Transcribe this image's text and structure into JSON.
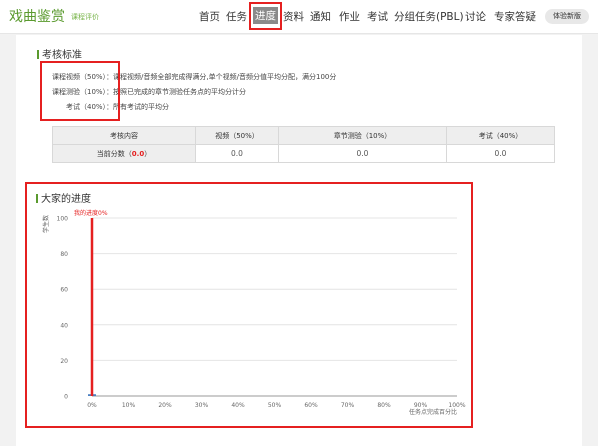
{
  "header": {
    "course_title": "戏曲鉴赏",
    "course_subtitle": "课程评价",
    "nav": [
      "首页",
      "任务",
      "进度",
      "资料",
      "通知",
      "作业",
      "考试",
      "分组任务(PBL)",
      "讨论",
      "专家答疑"
    ],
    "active_nav": "进度",
    "new_version_label": "体验新版"
  },
  "assessment": {
    "title": "考核标准",
    "lines": [
      {
        "label": "课程视频（50%）",
        "desc": "：课程视频/音频全部完成得满分,单个视频/音频分值平均分配，满分100分"
      },
      {
        "label": "课程测验（10%）",
        "desc": "：按照已完成的章节测验任务点的平均分计分"
      },
      {
        "label": "考试（40%）",
        "desc": "：所有考试的平均分"
      }
    ],
    "table": {
      "headers": [
        "考核内容",
        "视频（50%）",
        "章节测验（10%）",
        "考试（40%）"
      ],
      "row_label": "当前分数（",
      "row_value": "0.0",
      "row_label_end": "）",
      "values": [
        "0.0",
        "0.0",
        "0.0"
      ]
    }
  },
  "progress": {
    "title": "大家的进度",
    "chart_data": {
      "type": "bar",
      "categories": [
        "0%",
        "10%",
        "20%",
        "30%",
        "40%",
        "50%",
        "60%",
        "70%",
        "80%",
        "90%",
        "100%"
      ],
      "values": [
        1,
        0,
        0,
        0,
        0,
        0,
        0,
        0,
        0,
        0,
        0
      ],
      "ylim": [
        0,
        100
      ],
      "yticks": [
        0,
        20,
        40,
        60,
        80,
        100
      ],
      "ylabel": "学生数",
      "xlabel": "任务点完成百分比",
      "marker_label": "我的进度0%",
      "marker_x": "0%",
      "colors": {
        "bar": "#4a7fc1",
        "marker": "#e52020",
        "grid": "#e4e4e4"
      }
    }
  }
}
